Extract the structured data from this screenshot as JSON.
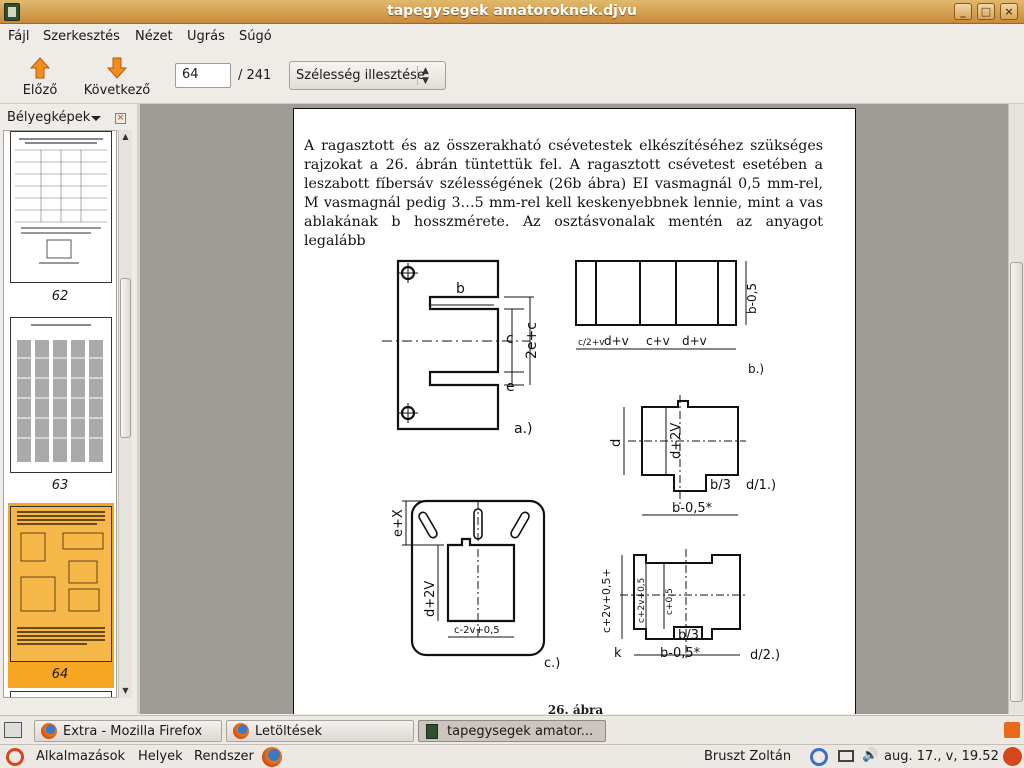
{
  "window": {
    "title": "tapegysegek amatoroknek.djvu"
  },
  "menu": [
    "Fájl",
    "Szerkesztés",
    "Nézet",
    "Ugrás",
    "Súgó"
  ],
  "toolbar": {
    "prev_label": "Előző",
    "next_label": "Következő",
    "page_value": "64",
    "page_total": "/ 241",
    "zoom_label": "Szélesség illesztése"
  },
  "sidebar": {
    "title": "Bélyegképek",
    "thumbnails": [
      {
        "label": "62"
      },
      {
        "label": "63"
      },
      {
        "label": "64",
        "selected": true
      }
    ]
  },
  "document": {
    "paragraph": "A ragasztott és az összerakható csévetestek elkészítéséhez szükséges rajzokat a 26. ábrán tüntettük fel. A ragasztott csévetest esetében a leszabott fíbersáv szélességének (26b ábra) EI vasmagnál 0,5 mm-rel, M vasmagnál pedig 3…5 mm-rel kell keskenyebbnek lennie, mint a vas ablakának b hosszmérete. Az osztásvonalak mentén az anyagot legalább",
    "figure_caption": "26. ábra",
    "figure_labels": {
      "a": "a.)",
      "b_view": "b.)",
      "c": "c.)",
      "d1": "d/1.)",
      "d2": "d/2.)",
      "dim_b": "b",
      "dim_c": "c",
      "dim_e": "e",
      "dim_2ec": "2e+c",
      "dim_b05": "b-0,5",
      "dim_c2v": "c/2+v",
      "dim_dv": "d+v",
      "dim_cv": "c+v",
      "dim_d": "d",
      "dim_d2v": "d+2V",
      "dim_b3": "b/3",
      "dim_b05s": "b-0,5*",
      "dim_ex": "e+X",
      "dim_c2v05": "c-2v+0,5",
      "dim_k": "k",
      "dim_c2v05p": "c+2v+0,5+",
      "dim_c2v05b": "c+2v+0,5",
      "dim_c05": "c+0,5"
    }
  },
  "taskbar": {
    "tasks": [
      {
        "label": "Extra - Mozilla Firefox"
      },
      {
        "label": "Letöltések"
      },
      {
        "label": "tapegysegek amator...",
        "active": true
      }
    ]
  },
  "panel": {
    "apps": "Alkalmazások",
    "places": "Helyek",
    "system": "Rendszer",
    "user": "Bruszt Zoltán",
    "clock": "aug. 17., v, 19.52"
  },
  "colors": {
    "titlebar": "#d9a552",
    "selected_thumb": "#f5a623",
    "doc_bg": "#9f9c97"
  }
}
